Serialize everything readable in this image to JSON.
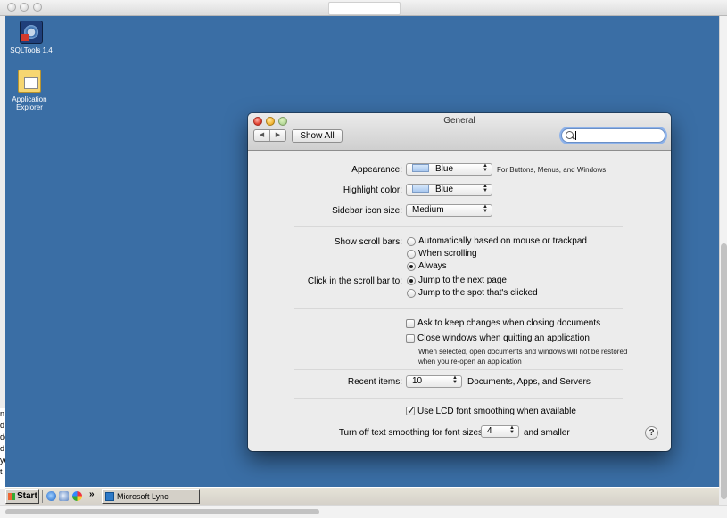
{
  "outer_window": {
    "scrollbar": "vertical-scrollbar",
    "hscrollbar": "horizontal-scrollbar"
  },
  "desktop": {
    "icons": [
      {
        "label": "SQLTools 1.4",
        "icon": "sqltools-icon"
      },
      {
        "label": "Application Explorer",
        "icon": "folder-icon"
      }
    ],
    "left_strip_text": "n\nd\nde\nd\nye\nt"
  },
  "taskbar": {
    "start_label": "Start",
    "chevron": "»",
    "task_button_label": "Microsoft Lync"
  },
  "prefs": {
    "title": "General",
    "back_icon": "◀",
    "forward_icon": "▶",
    "show_all": "Show All",
    "search_value": "",
    "appearance": {
      "label": "Appearance:",
      "value": "Blue",
      "note": "For Buttons, Menus, and Windows"
    },
    "highlight": {
      "label": "Highlight color:",
      "value": "Blue"
    },
    "sidebar_icon_size": {
      "label": "Sidebar icon size:",
      "value": "Medium"
    },
    "scroll_bars": {
      "label": "Show scroll bars:",
      "options": [
        "Automatically based on mouse or trackpad",
        "When scrolling",
        "Always"
      ],
      "selected": "Always"
    },
    "click_scroll": {
      "label": "Click in the scroll bar to:",
      "options": [
        "Jump to the next page",
        "Jump to the spot that's clicked"
      ],
      "selected": "Jump to the next page"
    },
    "ask_keep_changes": {
      "label": "Ask to keep changes when closing documents",
      "checked": false
    },
    "close_windows": {
      "label": "Close windows when quitting an application",
      "checked": false,
      "note": "When selected, open documents and windows will not be restored when you re-open an application"
    },
    "recent_items": {
      "label": "Recent items:",
      "value": "10",
      "note": "Documents, Apps, and Servers"
    },
    "lcd_smoothing": {
      "label": "Use LCD font smoothing when available",
      "checked": true
    },
    "text_smoothing": {
      "label": "Turn off text smoothing for font sizes",
      "value": "4",
      "note": "and smaller"
    },
    "help": "?"
  },
  "colors": {
    "desktop_bg": "#3a6ea5",
    "window_bg": "#ececec",
    "search_focus": "#8db2ea"
  }
}
